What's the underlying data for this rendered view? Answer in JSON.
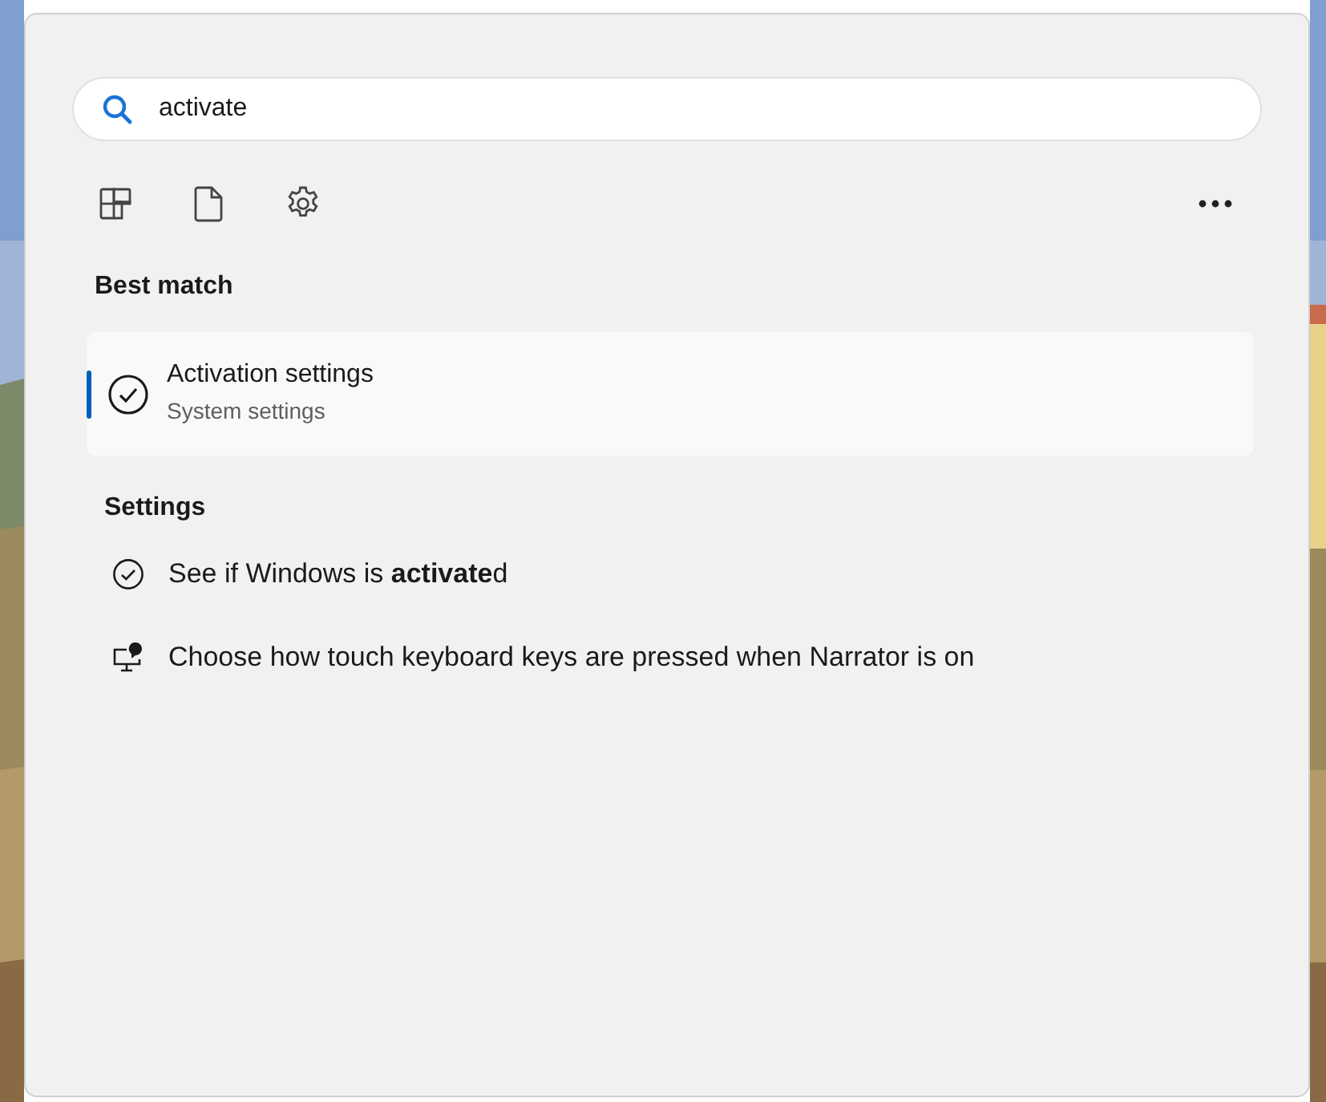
{
  "search": {
    "value": "activate"
  },
  "filters": [
    {
      "kind": "apps"
    },
    {
      "kind": "documents"
    },
    {
      "kind": "settings"
    }
  ],
  "best_match": {
    "heading": "Best match",
    "item": {
      "title": "Activation settings",
      "subtitle": "System settings",
      "kind": "check",
      "selected": true
    }
  },
  "settings": {
    "heading": "Settings",
    "items": [
      {
        "text": "See if Windows is **activate**d",
        "kind": "check"
      },
      {
        "text": "Choose how touch keyboard keys are pressed when Narrator is on",
        "kind": "narrator"
      }
    ]
  }
}
